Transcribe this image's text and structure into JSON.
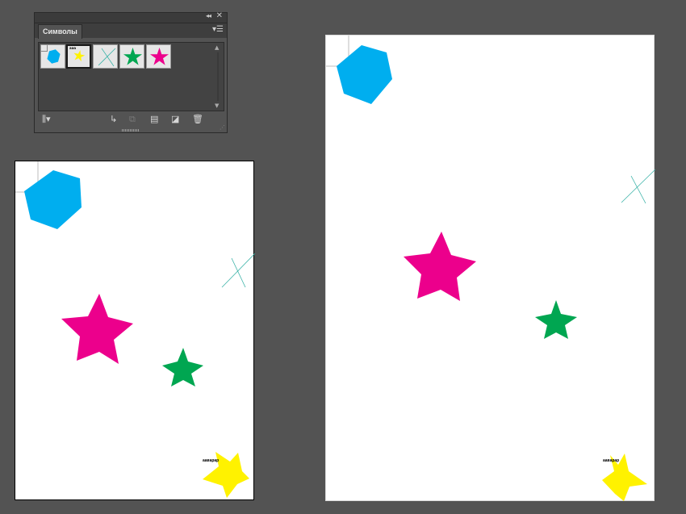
{
  "panel": {
    "tab_label": "Символы",
    "collapse_glyph": "◂◂",
    "close_glyph": "✕",
    "menu_glyph": "▾☰",
    "symbols": [
      {
        "name": "hexagon",
        "color": "#00AEEF"
      },
      {
        "name": "star-with-text",
        "color": "#FFF200"
      },
      {
        "name": "cross-lines",
        "color": "#3BB3A8"
      },
      {
        "name": "green-star",
        "color": "#00A651"
      },
      {
        "name": "magenta-star",
        "color": "#EC008C"
      }
    ],
    "swatch_text": "ааа",
    "bottom_icons": [
      "library-icon",
      "place-symbol-icon",
      "break-link-icon",
      "symbol-options-icon",
      "new-symbol-icon",
      "delete-icon"
    ]
  },
  "artboard": {
    "label_text": "ааварар"
  },
  "colors": {
    "background": "#535353",
    "cyan": "#00AEEF",
    "yellow": "#FFF200",
    "green": "#00A651",
    "magenta": "#EC008C",
    "teal_line": "#3BB3A8"
  }
}
